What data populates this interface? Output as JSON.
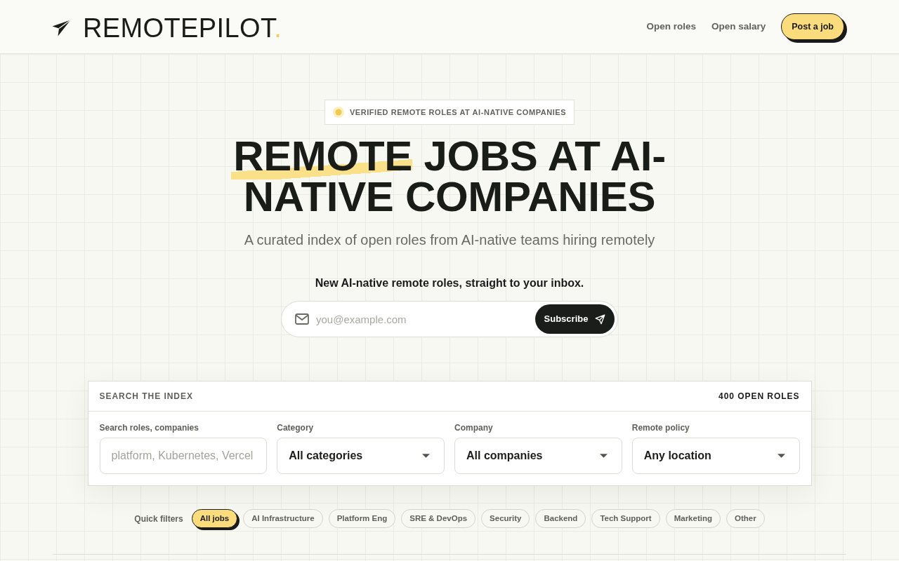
{
  "header": {
    "logo": {
      "name": "REMOTEPILOT",
      "dot": "."
    },
    "nav": [
      {
        "label": "Open roles"
      },
      {
        "label": "Open salary"
      }
    ],
    "cta": "Post a job"
  },
  "hero": {
    "badge": "VERIFIED REMOTE ROLES AT AI-NATIVE COMPANIES",
    "title": {
      "highlighted": "REMOTE",
      "rest": "JOBS AT AI-NATIVE COMPANIES"
    },
    "subtitle": "A curated index of open roles from AI-native teams hiring remotely",
    "newsletter": {
      "prompt": "New AI-native remote roles, straight to your inbox.",
      "email_placeholder": "you@example.com",
      "button": "Subscribe"
    }
  },
  "search": {
    "title": "SEARCH THE INDEX",
    "count": "400 OPEN ROLES",
    "fields": [
      {
        "kind": "text",
        "label": "Search roles, companies",
        "placeholder": "platform, Kubernetes, Vercel"
      },
      {
        "kind": "select",
        "label": "Category",
        "value": "All categories"
      },
      {
        "kind": "select",
        "label": "Company",
        "value": "All companies"
      },
      {
        "kind": "select",
        "label": "Remote policy",
        "value": "Any location"
      }
    ]
  },
  "quick_filters": {
    "label": "Quick filters",
    "chips": [
      {
        "label": "All jobs",
        "selected": true
      },
      {
        "label": "AI Infrastructure",
        "selected": false
      },
      {
        "label": "Platform Eng",
        "selected": false
      },
      {
        "label": "SRE & DevOps",
        "selected": false
      },
      {
        "label": "Security",
        "selected": false
      },
      {
        "label": "Backend",
        "selected": false
      },
      {
        "label": "Tech Support",
        "selected": false
      },
      {
        "label": "Marketing",
        "selected": false
      },
      {
        "label": "Other",
        "selected": false
      }
    ]
  }
}
